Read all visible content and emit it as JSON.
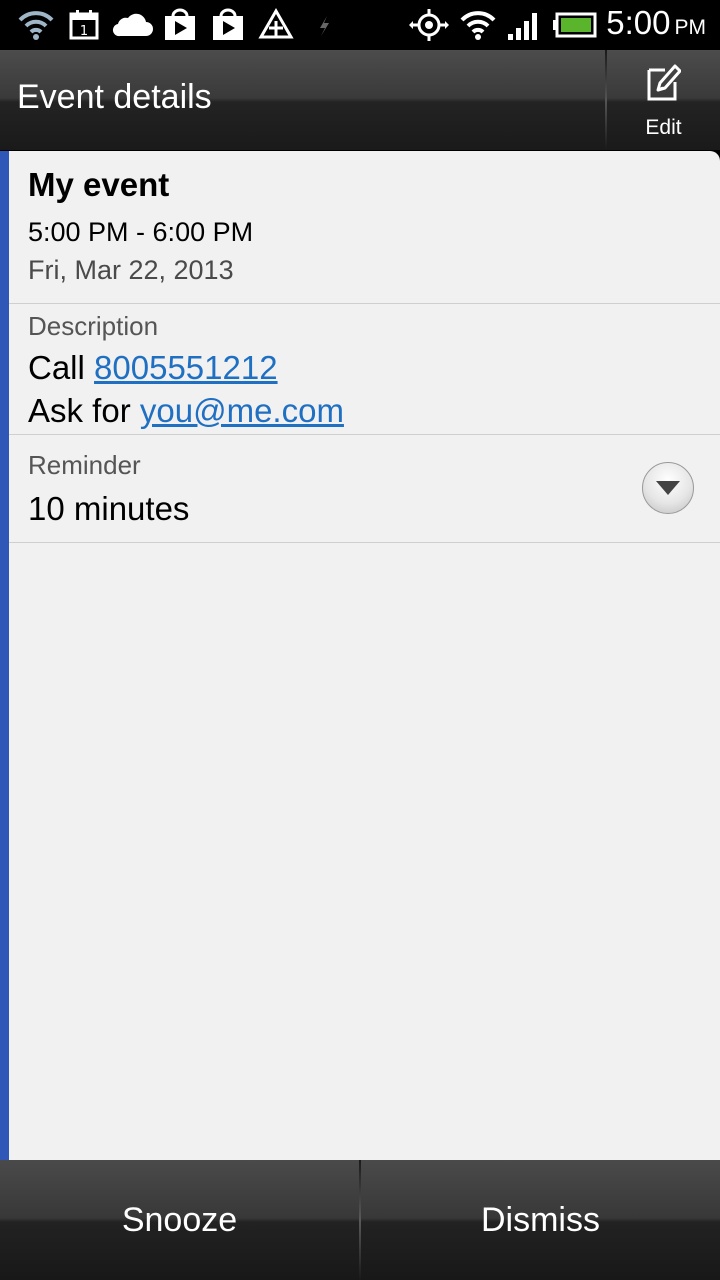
{
  "status_bar": {
    "time": "5:00",
    "ampm": "PM",
    "icons": [
      "wifi-icon",
      "calendar-icon",
      "cloud-icon",
      "play-store-icon",
      "play-store-icon",
      "tethering-icon",
      "usb-icon",
      "gps-icon",
      "wifi-signal-icon",
      "cell-signal-icon",
      "battery-icon"
    ],
    "calendar_day": "1"
  },
  "action_bar": {
    "title": "Event details",
    "edit_label": "Edit"
  },
  "event": {
    "title": "My event",
    "time_range": "5:00 PM - 6:00 PM",
    "date": "Fri, Mar 22, 2013",
    "accent_color": "#2f57b8"
  },
  "description": {
    "label": "Description",
    "line1_prefix": "Call",
    "phone": "8005551212",
    "line2_prefix": "Ask for",
    "email": "you@me.com",
    "link_color": "#1f6fc2"
  },
  "reminder": {
    "label": "Reminder",
    "value": "10 minutes"
  },
  "buttons": {
    "snooze": "Snooze",
    "dismiss": "Dismiss"
  }
}
